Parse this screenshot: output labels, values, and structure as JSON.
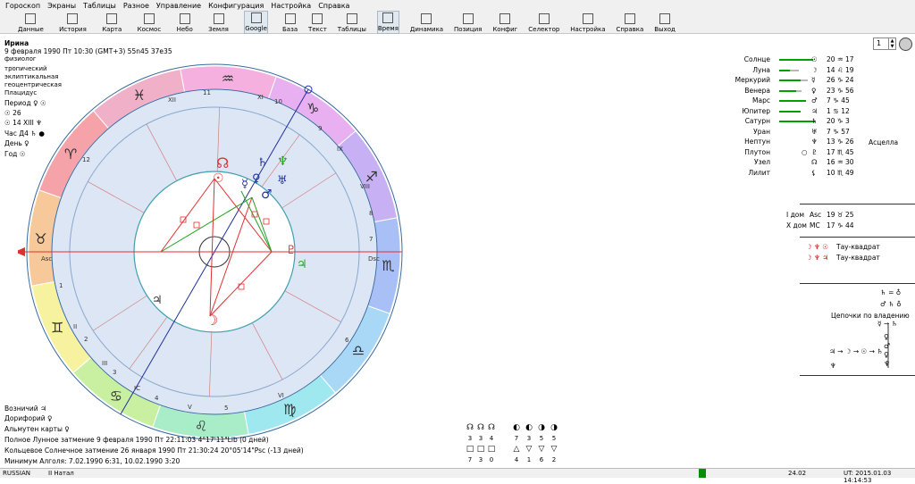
{
  "menu": [
    "Гороскоп",
    "Экраны",
    "Таблицы",
    "Разное",
    "Управление",
    "Конфигурация",
    "Настройка",
    "Справка"
  ],
  "toolbar_left": [
    {
      "label": "Данные",
      "icon": "data-icon"
    },
    {
      "label": "История",
      "icon": "history-icon"
    },
    {
      "label": "Карта",
      "icon": "chart-icon"
    },
    {
      "label": "Космос",
      "icon": "cosmos-icon"
    },
    {
      "label": "Небо",
      "icon": "sky-icon"
    },
    {
      "label": "Земля",
      "icon": "earth-icon"
    },
    {
      "label": "Google",
      "icon": "google-icon"
    }
  ],
  "toolbar_right": [
    {
      "label": "База",
      "icon": "database-icon"
    },
    {
      "label": "Текст",
      "icon": "text-icon"
    },
    {
      "label": "Таблицы",
      "icon": "tables-icon"
    },
    {
      "label": "Время",
      "icon": "time-icon"
    },
    {
      "label": "Динамика",
      "icon": "dynamics-icon"
    },
    {
      "label": "Позиция",
      "icon": "position-icon"
    },
    {
      "label": "Конфиг",
      "icon": "config-icon"
    },
    {
      "label": "Селектор",
      "icon": "selector-icon"
    },
    {
      "label": "Настройка",
      "icon": "settings-icon"
    },
    {
      "label": "Справка",
      "icon": "help-icon"
    },
    {
      "label": "Выход",
      "icon": "exit-icon"
    }
  ],
  "page_num": "1",
  "person": {
    "name": "Ирина",
    "datetime": "9 февраля 1990  Пт  10:30 (GMT+3) 55n45  37e35",
    "line3": "физиолог"
  },
  "chart_settings": [
    "тропический",
    "эклиптикальная",
    "геоцентрическая",
    "Плацидус"
  ],
  "period": {
    "label": "Период",
    "ruler": "♀ ☉",
    "sun_line": "☉  26",
    "moon_line": "☉  14 XIII  ♆",
    "hour": "Час Д4  ♄  ●",
    "day": "День  ♀",
    "year": "Год  ☉"
  },
  "houses": [
    "XII",
    "11",
    "XI",
    "10",
    "9",
    "IX",
    "VIII",
    "8",
    "7",
    "Dsc",
    "6",
    "VI",
    "5",
    "V",
    "4",
    "IC",
    "III",
    "3",
    "2",
    "II",
    "1",
    "Asc",
    "12"
  ],
  "planets": [
    {
      "name": "Солнце",
      "marker": "",
      "glyph": "☉",
      "pos": "20 ♒ 17",
      "bar": 38,
      "bar2": 0
    },
    {
      "name": "Луна",
      "marker": "",
      "glyph": "☽",
      "pos": "14 ♌ 19",
      "bar": 22,
      "bar2": 10
    },
    {
      "name": "Меркурий",
      "marker": "",
      "glyph": "☿",
      "pos": "26 ♑ 24",
      "bar": 32,
      "bar2": 8
    },
    {
      "name": "Венера",
      "marker": "",
      "glyph": "♀",
      "pos": "23 ♑ 56",
      "bar": 25,
      "bar2": 6
    },
    {
      "name": "Марс",
      "marker": "",
      "glyph": "♂",
      "pos": "7 ♑ 45",
      "bar": 30,
      "bar2": 0
    },
    {
      "name": "Юпитер",
      "marker": "",
      "glyph": "♃",
      "pos": "1 ♋ 12",
      "bar": 24,
      "bar2": 0
    },
    {
      "name": "Сатурн",
      "marker": "",
      "glyph": "♄",
      "pos": "20 ♑ 3",
      "bar": 40,
      "bar2": 0
    },
    {
      "name": "Уран",
      "marker": "",
      "glyph": "♅",
      "pos": "7 ♑ 57",
      "bar": 0,
      "bar2": 0
    },
    {
      "name": "Нептун",
      "marker": "",
      "glyph": "♆",
      "pos": "13 ♑ 26",
      "bar": 0,
      "bar2": 0
    },
    {
      "name": "Плутон",
      "marker": "○",
      "glyph": "♇",
      "pos": "17 ♏ 45",
      "bar": 0,
      "bar2": 0
    },
    {
      "name": "Узел",
      "marker": "",
      "glyph": "☊",
      "pos": "16 ♒ 30",
      "bar": 0,
      "bar2": 0
    },
    {
      "name": "Лилит",
      "marker": "",
      "glyph": "⚸",
      "pos": "10 ♏ 49",
      "bar": 0,
      "bar2": 0
    }
  ],
  "neptune_extra": "Асцелла",
  "angles": [
    {
      "label": "I дом",
      "glyph": "Asc",
      "pos": "19 ♉ 25"
    },
    {
      "label": "X дом",
      "glyph": "MC",
      "pos": "17 ♑ 44"
    }
  ],
  "configs": [
    {
      "sym": "☽ ♆ ☉",
      "label": "Тау-квадрат"
    },
    {
      "sym": "☽ ♆ ♃",
      "label": "Тау-квадрат"
    }
  ],
  "dispositors": {
    "line1": "♄ = ♁",
    "line2": "♂ ♄ ♁",
    "title": "Цепочки по владению",
    "line4": "☿ → ♄",
    "chain": "♃ → ☽ → ☉ → ♄"
  },
  "bottom": {
    "vozn": "Возничий  ♃",
    "dorif": "Дорифорий  ♀",
    "almuten": "Альмутен карты  ♀",
    "eclipse1": "Полное Лунное затмение 9 февраля 1990 Пт 22:11:03  4°17'11\"Lib (0 дней)",
    "eclipse2": "Кольцевое Солнечное затмение 26 января 1990 Пт 21:30:24 20°05'14\"Psc (-13 дней)",
    "algol": "Минимум Алголя: 7.02.1990  6:31,  10.02.1990  3:20"
  },
  "aspects_top": [
    {
      "sym": "☊",
      "n": "3"
    },
    {
      "sym": "☊",
      "n": "3"
    },
    {
      "sym": "☊",
      "n": "4"
    },
    {
      "sym": "◐",
      "n": "7"
    },
    {
      "sym": "◐",
      "n": "3"
    },
    {
      "sym": "◑",
      "n": "5"
    },
    {
      "sym": "◑",
      "n": "5"
    }
  ],
  "aspects_bottom": [
    {
      "sym": "□",
      "n": "7"
    },
    {
      "sym": "□",
      "n": "3"
    },
    {
      "sym": "□",
      "n": "0"
    },
    {
      "sym": "△",
      "n": "4"
    },
    {
      "sym": "▽",
      "n": "1"
    },
    {
      "sym": "▽",
      "n": "6"
    },
    {
      "sym": "▽",
      "n": "2"
    }
  ],
  "status": {
    "lang": "RUSSIAN",
    "mode": "II Натал",
    "version": "24.02",
    "ut": "UT: 2015.01.03 14:14:53"
  },
  "colors": {
    "green": "#00a000",
    "red": "#e00000",
    "ring": "#c8d8f0"
  }
}
